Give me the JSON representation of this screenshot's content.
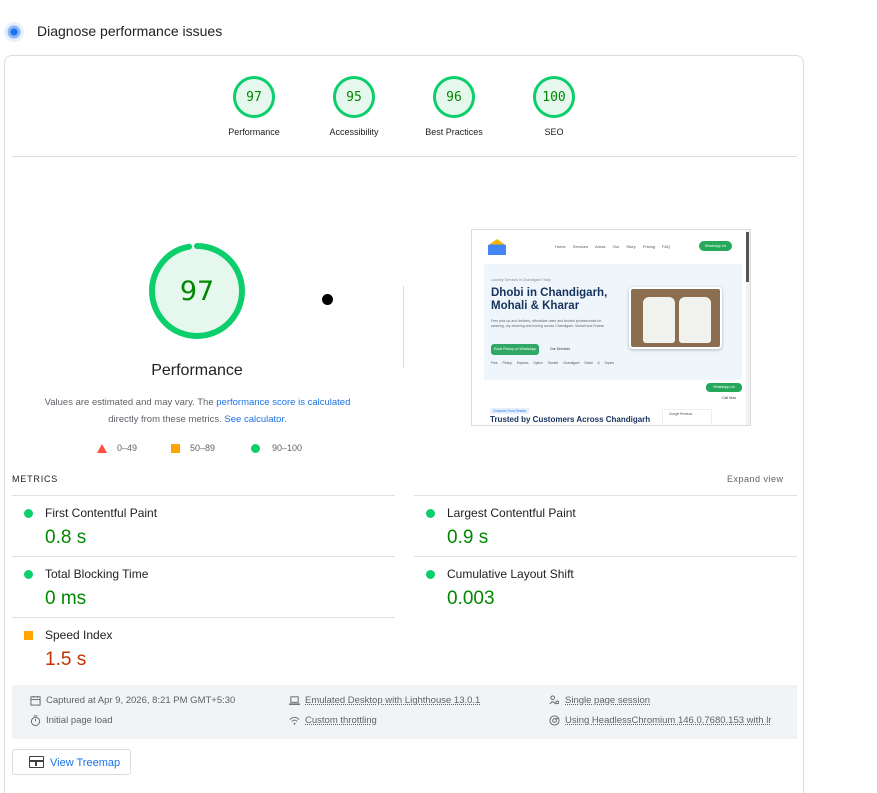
{
  "header": {
    "title": "Diagnose performance issues"
  },
  "categories": [
    {
      "label": "Performance",
      "score": "97"
    },
    {
      "label": "Accessibility",
      "score": "95"
    },
    {
      "label": "Best Practices",
      "score": "96"
    },
    {
      "label": "SEO",
      "score": "100"
    }
  ],
  "performance": {
    "score": "97",
    "score_fraction": 0.97,
    "title": "Performance",
    "desc_part1": "Values are estimated and may vary. The ",
    "desc_link1": "performance score is calculated",
    "desc_part2": " directly from these metrics. ",
    "desc_link2": "See calculator."
  },
  "legend": {
    "poor": "0–49",
    "average": "50–89",
    "good": "90–100"
  },
  "colors": {
    "good": "#0cce6b",
    "average": "#ffa400",
    "poor": "#ff4e42",
    "link": "#1a73e8"
  },
  "screenshot": {
    "nav_links": "Home Services Areas Our Story Pricing FAQ",
    "nav_button": "WhatsApp Us",
    "eyebrow": "Laundry Services in Chandigarh Tricity",
    "headline": "Dhobi in Chandigarh, Mohali & Kharar",
    "subtext": "Free pick-up and delivery, affordable rates and trusted professionals for washing, dry cleaning and ironing across Chandigarh, Mohali and Kharar.",
    "cta_primary": "Book Pickup on WhatsApp",
    "cta_secondary": "Our Services",
    "chips": "Free Pickup Express Option Trusted Chandigarh Dhobi & Dryers",
    "float_button": "WhatsApp Us",
    "call": "Call Now",
    "badge": "Customer Trust Review",
    "trust_heading": "Trusted by Customers Across Chandigarh",
    "google_review": "Google Reviews"
  },
  "metrics": {
    "label": "METRICS",
    "expand": "Expand view",
    "fcp": {
      "name": "First Contentful Paint",
      "value": "0.8 s"
    },
    "lcp": {
      "name": "Largest Contentful Paint",
      "value": "0.9 s"
    },
    "tbt": {
      "name": "Total Blocking Time",
      "value": "0 ms"
    },
    "cls": {
      "name": "Cumulative Layout Shift",
      "value": "0.003"
    },
    "si": {
      "name": "Speed Index",
      "value": "1.5 s"
    }
  },
  "info": {
    "captured": "Captured at Apr 9, 2026, 8:21 PM GMT+5:30",
    "initial": "Initial page load",
    "device": "Emulated Desktop with Lighthouse 13.0.1",
    "throttling": "Custom throttling",
    "session": "Single page session",
    "browser": "Using HeadlessChromium 146.0.7680.153 with lr"
  },
  "treemap": {
    "label": "View Treemap"
  }
}
